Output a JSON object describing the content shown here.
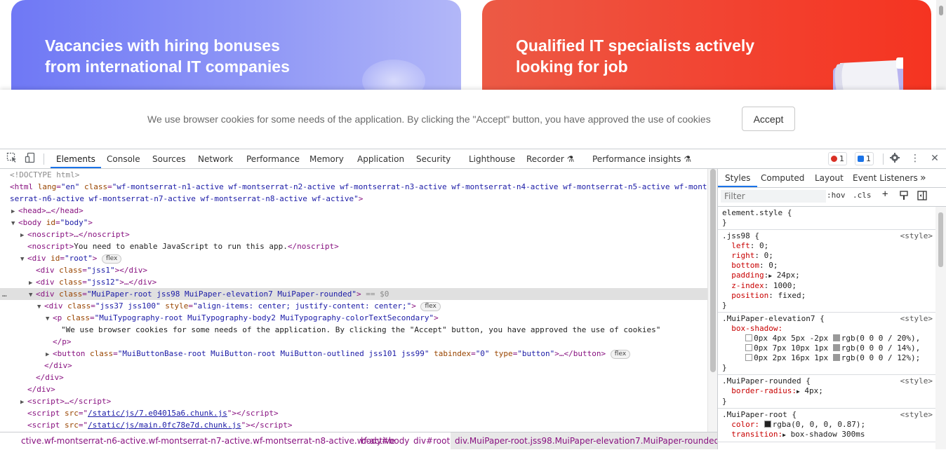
{
  "page": {
    "left_card": {
      "title": "Vacancies with hiring bonuses from international IT companies"
    },
    "right_card": {
      "title": "Qualified IT specialists actively looking for job"
    }
  },
  "cookie_banner": {
    "message": "We use browser cookies for some needs of the application. By clicking the \"Accept\" button, you have approved the use of cookies",
    "accept_label": "Accept"
  },
  "devtools": {
    "tabs": [
      "Elements",
      "Console",
      "Sources",
      "Network",
      "Performance",
      "Memory",
      "Application",
      "Security",
      "Lighthouse",
      "Recorder",
      "Performance insights"
    ],
    "beaker_icon": "⚗",
    "errors_count": "1",
    "messages_count": "1",
    "dom": {
      "l1": "<!DOCTYPE html>",
      "l2_attr": "\"en\"",
      "l2_class_a": "\"wf-montserrat-n1-active wf-montserrat-n2-active wf-montserrat-n3-active wf-montserrat-n4-active wf-montserrat-n5-active wf-mont",
      "l2_class_b": "serrat-n6-active wf-montserrat-n7-active wf-montserrat-n8-active wf-active\"",
      "head": "<head>…</head>",
      "body_id": "\"body\"",
      "noscript1": "<noscript>…</noscript>",
      "noscript2_text": "You need to enable JavaScript to run this app.",
      "root_id": "\"root\"",
      "flex": "flex",
      "jss1": "\"jss1\"",
      "jss12": "\"jss12\"",
      "paper_class": "\"MuiPaper-root jss98 MuiPaper-elevation7 MuiPaper-rounded\"",
      "eq0": "== $0",
      "jss37_class": "\"jss37 jss100\"",
      "jss37_style": "\"align-items: center; justify-content: center;\"",
      "p_class": "\"MuiTypography-root MuiTypography-body2 MuiTypography-colorTextSecondary\"",
      "p_text": "\"We use browser cookies for some needs of the application. By clicking the \"Accept\" button, you have approved the use of cookies\"",
      "button_class": "\"MuiButtonBase-root MuiButton-root MuiButton-outlined jss101 jss99\"",
      "tabindex": "\"0\"",
      "btn_type": "\"button\"",
      "script_link1": "/static/js/7.e04015a6.chunk.js",
      "script_link2": "/static/js/main.0fc78e7d.chunk.js"
    },
    "breadcrumbs": [
      "ctive.wf-montserrat-n6-active.wf-montserrat-n7-active.wf-montserrat-n8-active.wf-active",
      "body#body",
      "div#root",
      "div.MuiPaper-root.jss98.MuiPaper-elevation7.MuiPaper-rounded"
    ],
    "styles": {
      "tabs": [
        "Styles",
        "Computed",
        "Layout",
        "Event Listeners"
      ],
      "filter_placeholder": "Filter",
      "hov": ":hov",
      "cls": ".cls",
      "style_src": "<style>",
      "element_style": "element.style {",
      "jss98": {
        "selector": ".jss98 {",
        "props": [
          {
            "n": "left",
            "v": "0;"
          },
          {
            "n": "right",
            "v": "0;"
          },
          {
            "n": "bottom",
            "v": "0;"
          },
          {
            "n": "padding",
            "v": "24px;"
          },
          {
            "n": "z-index",
            "v": "1000;"
          },
          {
            "n": "position",
            "v": "fixed;"
          }
        ]
      },
      "elev7": {
        "selector": ".MuiPaper-elevation7 {",
        "prop": "box-shadow:",
        "shadows": [
          {
            "v": "0px 4px 5px -2px",
            "c": "rgb(0 0 0 / 20%),"
          },
          {
            "v": "0px 7px 10px 1px",
            "c": "rgb(0 0 0 / 14%),"
          },
          {
            "v": "0px 2px 16px 1px",
            "c": "rgb(0 0 0 / 12%);"
          }
        ]
      },
      "rounded": {
        "selector": ".MuiPaper-rounded {",
        "prop": "border-radius:",
        "val": "4px;"
      },
      "root": {
        "selector": ".MuiPaper-root {",
        "color_prop": "color:",
        "color_val": "rgba(0, 0, 0, 0.87);",
        "trans_prop": "transition:",
        "trans_val": "box-shadow 300ms"
      }
    }
  }
}
